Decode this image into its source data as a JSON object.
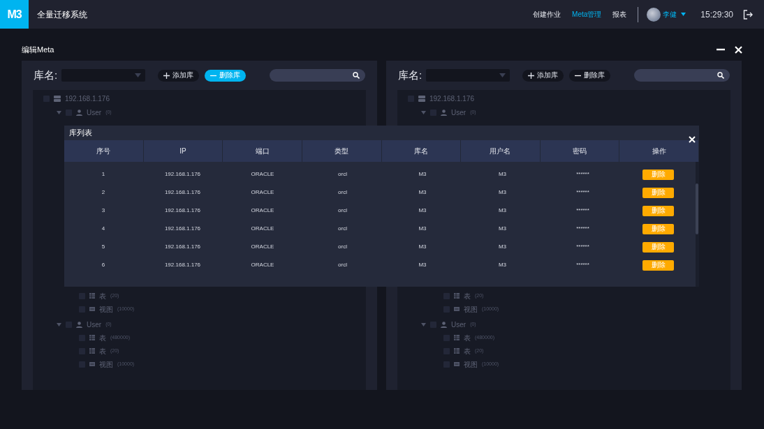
{
  "header": {
    "logo": "M3",
    "title": "全量迁移系统",
    "nav": [
      {
        "label": "创建作业",
        "selected": false
      },
      {
        "label": "Meta管理",
        "selected": true
      },
      {
        "label": "报表",
        "selected": false
      }
    ],
    "user": {
      "name": "李健"
    },
    "time": "15:29:30"
  },
  "page_title": "编辑Meta",
  "panels": [
    {
      "db_label": "库名:",
      "add_button": "添加库",
      "remove_button": {
        "label": "删除库",
        "selected": true
      },
      "tree_above": [
        {
          "kind": "server",
          "label": "192.168.1.176",
          "checked": false,
          "children": [
            {
              "kind": "user",
              "label": "User",
              "count": "(0)",
              "checked": false,
              "expanded": true
            }
          ]
        }
      ],
      "tree_below": {
        "leaves": [
          {
            "kind": "table",
            "label": "表",
            "count": "(20)",
            "checked": false
          },
          {
            "kind": "view",
            "label": "视图",
            "count": "(10000)",
            "checked": false
          }
        ],
        "users": [
          {
            "kind": "user",
            "label": "User",
            "count": "(0)",
            "checked": false,
            "expanded": true,
            "children": [
              {
                "kind": "table",
                "label": "表",
                "count": "(480000)",
                "checked": false
              },
              {
                "kind": "table",
                "label": "表",
                "count": "(20)",
                "checked": false
              },
              {
                "kind": "view",
                "label": "视图",
                "count": "(10000)",
                "checked": false
              }
            ]
          }
        ]
      }
    },
    {
      "db_label": "库名:",
      "add_button": "添加库",
      "remove_button": {
        "label": "删除库",
        "selected": false
      },
      "tree_above": [
        {
          "kind": "server",
          "label": "192.168.1.176",
          "checked": false,
          "children": [
            {
              "kind": "user",
              "label": "User",
              "count": "(0)",
              "checked": false,
              "expanded": true
            }
          ]
        }
      ],
      "tree_below": {
        "leaves": [
          {
            "kind": "table",
            "label": "表",
            "count": "(20)",
            "checked": false
          },
          {
            "kind": "view",
            "label": "视图",
            "count": "(10000)",
            "checked": false
          }
        ],
        "users": [
          {
            "kind": "user",
            "label": "User",
            "count": "(0)",
            "checked": false,
            "expanded": true,
            "children": [
              {
                "kind": "table",
                "label": "表",
                "count": "(480000)",
                "checked": false
              },
              {
                "kind": "table",
                "label": "表",
                "count": "(20)",
                "checked": false
              },
              {
                "kind": "view",
                "label": "视图",
                "count": "(10000)",
                "checked": false
              }
            ]
          }
        ]
      }
    }
  ],
  "modal": {
    "title": "库列表",
    "columns": [
      "序号",
      "IP",
      "端口",
      "类型",
      "库名",
      "用户名",
      "密码",
      "操作"
    ],
    "rows": [
      {
        "cells": [
          "1",
          "192.168.1.176",
          "ORACLE",
          "orcl",
          "M3",
          "M3",
          "******"
        ],
        "action": "删除"
      },
      {
        "cells": [
          "2",
          "192.168.1.176",
          "ORACLE",
          "orcl",
          "M3",
          "M3",
          "******"
        ],
        "action": "删除"
      },
      {
        "cells": [
          "3",
          "192.168.1.176",
          "ORACLE",
          "orcl",
          "M3",
          "M3",
          "******"
        ],
        "action": "删除"
      },
      {
        "cells": [
          "4",
          "192.168.1.176",
          "ORACLE",
          "orcl",
          "M3",
          "M3",
          "******"
        ],
        "action": "删除"
      },
      {
        "cells": [
          "5",
          "192.168.1.176",
          "ORACLE",
          "orcl",
          "M3",
          "M3",
          "******"
        ],
        "action": "删除"
      },
      {
        "cells": [
          "6",
          "192.168.1.176",
          "ORACLE",
          "orcl",
          "M3",
          "M3",
          "******"
        ],
        "action": "删除"
      }
    ]
  }
}
